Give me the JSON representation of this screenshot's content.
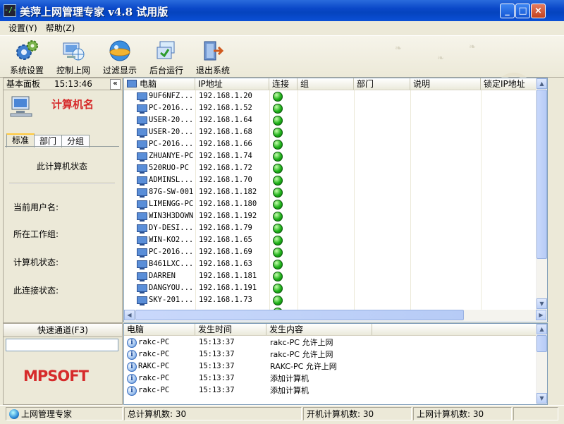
{
  "window": {
    "title": "美萍上网管理专家 v4.8 试用版",
    "app_icon_glyph": "-/-",
    "minimize_glyph": "_",
    "maximize_glyph": "□",
    "close_glyph": "×"
  },
  "menu": [
    {
      "label": "设置(Y)"
    },
    {
      "label": "帮助(Z)"
    }
  ],
  "toolbar": [
    {
      "label": "系统设置",
      "icon": "gears-icon"
    },
    {
      "label": "控制上网",
      "icon": "network-control-icon"
    },
    {
      "label": "过滤显示",
      "icon": "filter-display-icon"
    },
    {
      "label": "后台运行",
      "icon": "background-run-icon"
    },
    {
      "label": "退出系统",
      "icon": "exit-door-icon"
    }
  ],
  "left_panel": {
    "title": "基本面板",
    "time": "15:13:46",
    "collapse_glyph": "«",
    "computer_name_label": "计算机名",
    "tabs": [
      {
        "label": "标准",
        "active": true
      },
      {
        "label": "部门",
        "active": false
      },
      {
        "label": "分组",
        "active": false
      }
    ],
    "status_heading": "此计算机状态",
    "fields": [
      {
        "label": "当前用户名:"
      },
      {
        "label": "所在工作组:"
      },
      {
        "label": "计算机状态:"
      },
      {
        "label": "此连接状态:"
      }
    ]
  },
  "quick_channel": {
    "title": "快速通道(F3)",
    "input_value": ""
  },
  "logo": {
    "text": "MPSOFT",
    "color": "#d62b2b"
  },
  "computer_list": {
    "columns": [
      "电脑",
      "IP地址",
      "连接",
      "组",
      "部门",
      "说明",
      "锁定IP地址"
    ],
    "rows": [
      {
        "name": "9UF6NFZ...",
        "ip": "192.168.1.20",
        "connected": true
      },
      {
        "name": "PC-2016...",
        "ip": "192.168.1.52",
        "connected": true
      },
      {
        "name": "USER-20...",
        "ip": "192.168.1.64",
        "connected": true
      },
      {
        "name": "USER-20...",
        "ip": "192.168.1.68",
        "connected": true
      },
      {
        "name": "PC-2016...",
        "ip": "192.168.1.66",
        "connected": true
      },
      {
        "name": "ZHUANYE-PC",
        "ip": "192.168.1.74",
        "connected": true
      },
      {
        "name": "520RUO-PC",
        "ip": "192.168.1.72",
        "connected": true
      },
      {
        "name": "ADMINSL...",
        "ip": "192.168.1.70",
        "connected": true
      },
      {
        "name": "87G-SW-001",
        "ip": "192.168.1.182",
        "connected": true
      },
      {
        "name": "LIMENGG-PC",
        "ip": "192.168.1.180",
        "connected": true
      },
      {
        "name": "WIN3H3DOWN",
        "ip": "192.168.1.192",
        "connected": true
      },
      {
        "name": "DY-DESI...",
        "ip": "192.168.1.79",
        "connected": true
      },
      {
        "name": "WIN-KO2...",
        "ip": "192.168.1.65",
        "connected": true
      },
      {
        "name": "PC-2016...",
        "ip": "192.168.1.69",
        "connected": true
      },
      {
        "name": "B461LXC...",
        "ip": "192.168.1.63",
        "connected": true
      },
      {
        "name": "DARREN",
        "ip": "192.168.1.181",
        "connected": true
      },
      {
        "name": "DANGYOU...",
        "ip": "192.168.1.191",
        "connected": true
      },
      {
        "name": "SKY-201...",
        "ip": "192.168.1.73",
        "connected": true
      }
    ]
  },
  "event_log": {
    "columns": [
      "电脑",
      "发生时间",
      "发生内容"
    ],
    "rows": [
      {
        "computer": "rakc-PC",
        "time": "15:13:37",
        "content": "rakc-PC 允许上网"
      },
      {
        "computer": "rakc-PC",
        "time": "15:13:37",
        "content": "rakc-PC 允许上网"
      },
      {
        "computer": "RAKC-PC",
        "time": "15:13:37",
        "content": "RAKC-PC 允许上网"
      },
      {
        "computer": "rakc-PC",
        "time": "15:13:37",
        "content": "添加计算机"
      },
      {
        "computer": "rakc-PC",
        "time": "15:13:37",
        "content": "添加计算机"
      }
    ]
  },
  "status_bar": {
    "app_name": "上网管理专家",
    "total": "总计算机数: 30",
    "powered_on": "开机计算机数: 30",
    "online": "上网计算机数: 30"
  },
  "colors": {
    "title_bar": "#0A47C8",
    "face": "#ECE9D8",
    "computer_name": "#d62b2b",
    "led_on": "#1fb21a"
  }
}
